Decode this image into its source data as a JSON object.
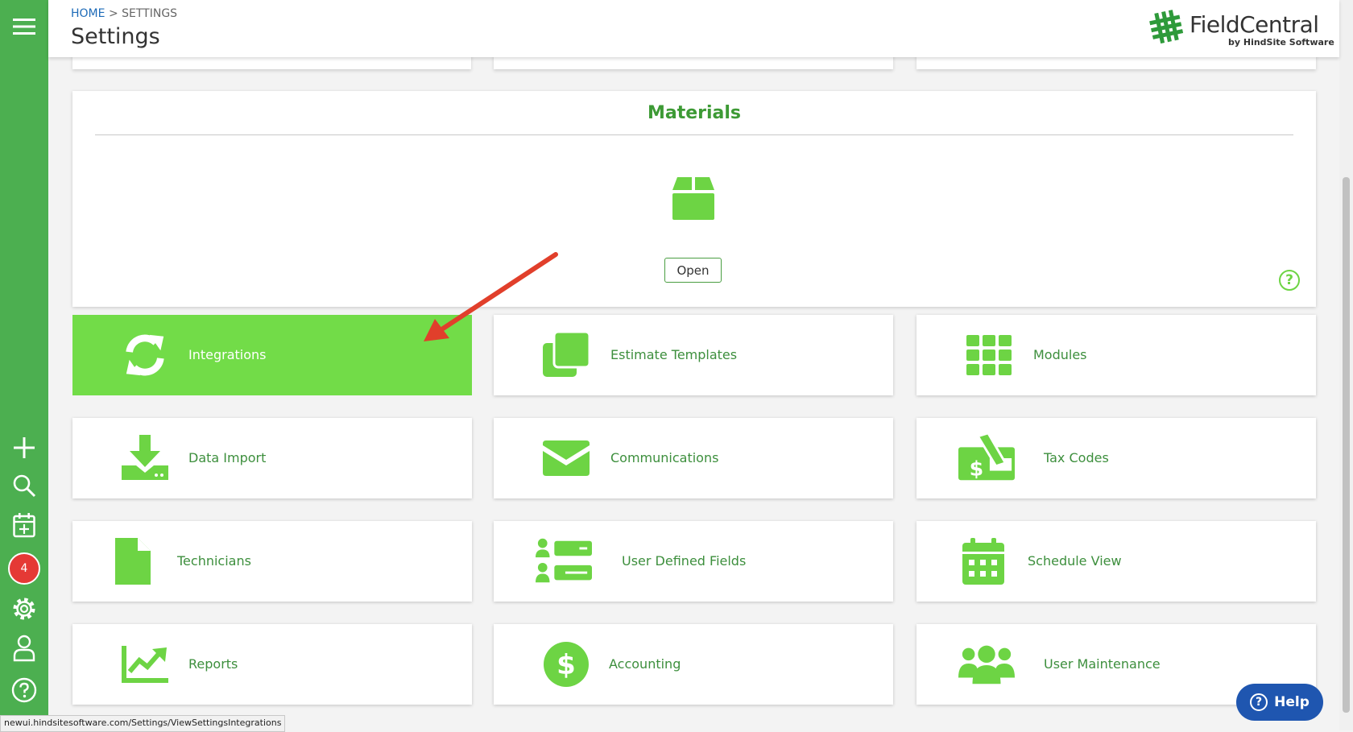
{
  "header": {
    "breadcrumb_home": "HOME",
    "breadcrumb_sep": ">",
    "breadcrumb_current": "SETTINGS",
    "title": "Settings",
    "logo_name": "FieldCentral",
    "logo_sub": "by HindSite Software"
  },
  "sidebar": {
    "badge_count": "4"
  },
  "materials": {
    "title": "Materials",
    "open_label": "Open",
    "help_glyph": "?"
  },
  "tiles": [
    {
      "label": "Integrations"
    },
    {
      "label": "Estimate Templates"
    },
    {
      "label": "Modules"
    },
    {
      "label": "Data Import"
    },
    {
      "label": "Communications"
    },
    {
      "label": "Tax Codes"
    },
    {
      "label": "Technicians"
    },
    {
      "label": "User Defined Fields"
    },
    {
      "label": "Schedule View"
    },
    {
      "label": "Reports"
    },
    {
      "label": "Accounting"
    },
    {
      "label": "User Maintenance"
    }
  ],
  "help_button": {
    "label": "Help"
  },
  "status_url": "newui.hindsitesoftware.com/Settings/ViewSettingsIntegrations",
  "colors": {
    "sidebar": "#4caf50",
    "tile_icon": "#6dd444",
    "active_tile": "#72dc48",
    "help_button": "#1f56b0",
    "arrow": "#e13f2b"
  }
}
